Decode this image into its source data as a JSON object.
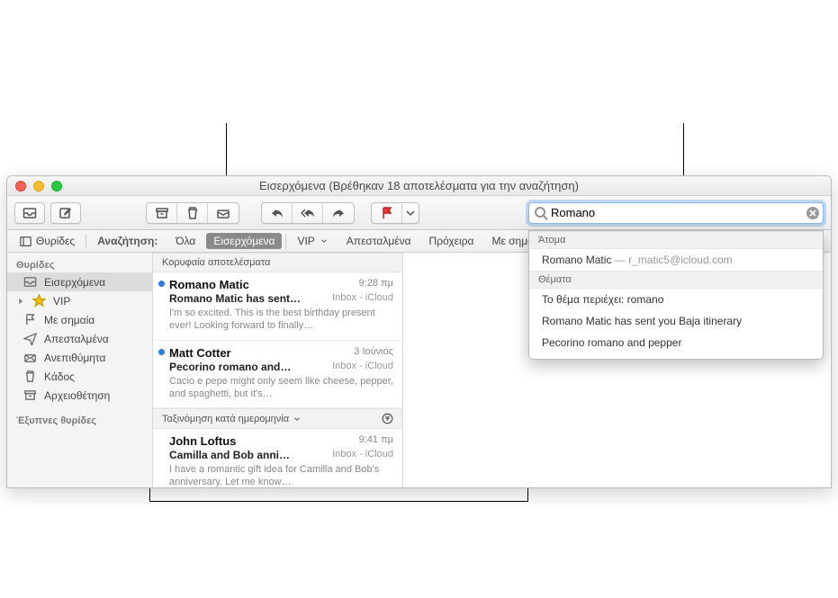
{
  "window": {
    "title": "Εισερχόμενα (Βρέθηκαν 18 αποτελέσματα για την αναζήτηση)"
  },
  "toolbar": {
    "icons": {
      "mailboxes": "mailboxes-icon",
      "compose": "compose-icon",
      "archive": "archive-icon",
      "trash": "trash-icon",
      "junk": "junk-icon",
      "reply": "reply-icon",
      "replyall": "reply-all-icon",
      "forward": "forward-icon",
      "flag": "flag-icon"
    }
  },
  "search": {
    "value": "Romano",
    "placeholder": ""
  },
  "favorites": {
    "sidebar_toggle": "Θυρίδες",
    "search_label": "Αναζήτηση:",
    "items": [
      {
        "label": "Όλα",
        "selected": false
      },
      {
        "label": "Εισερχόμενα",
        "selected": true
      },
      {
        "label": "VIP",
        "selected": false,
        "chevron": true
      },
      {
        "label": "Απεσταλμένα",
        "selected": false
      },
      {
        "label": "Πρόχειρα",
        "selected": false
      },
      {
        "label": "Με σημαία",
        "selected": false
      }
    ]
  },
  "sidebar": {
    "sections": [
      {
        "header": "Θυρίδες",
        "items": [
          {
            "icon": "inbox",
            "label": "Εισερχόμενα",
            "selected": true
          },
          {
            "icon": "star",
            "label": "VIP"
          },
          {
            "icon": "flag",
            "label": "Με σημαία"
          },
          {
            "icon": "sent",
            "label": "Απεσταλμένα"
          },
          {
            "icon": "junk",
            "label": "Ανεπιθύμητα"
          },
          {
            "icon": "trash",
            "label": "Κάδος"
          },
          {
            "icon": "archive",
            "label": "Αρχειοθέτηση"
          }
        ]
      },
      {
        "header": "Έξυπνες θυρίδες",
        "items": []
      }
    ]
  },
  "msglist": {
    "top_header": "Κορυφαία αποτελέσματα",
    "sort_header": "Ταξινόμηση κατά ημερομηνία",
    "messages_top": [
      {
        "unread": true,
        "sender": "Romano Matic",
        "date": "9:28 πμ",
        "subject": "Romano Matic has sent…",
        "mailbox": "Inbox - iCloud",
        "preview": "I'm so excited. This is the best birthday present ever! Looking forward to finally…"
      },
      {
        "unread": true,
        "sender": "Matt Cotter",
        "date": "3 Ιούνιος",
        "subject": "Pecorino romano and…",
        "mailbox": "Inbox - iCloud",
        "preview": "Cacio e pepe might only seem like cheese, pepper, and spaghetti, but it's…"
      }
    ],
    "messages_rest": [
      {
        "unread": false,
        "sender": "John Loftus",
        "date": "9:41 πμ",
        "subject": "Camilla and Bob anni…",
        "mailbox": "Inbox - iCloud",
        "preview": "I have a romantic gift idea for Camilla and Bob's anniversary. Let me know…"
      }
    ]
  },
  "suggestions": {
    "people_header": "Άτομα",
    "people": [
      {
        "name": "Romano Matic",
        "email": "r_matic5@icloud.com"
      }
    ],
    "subjects_header": "Θέματα",
    "subjects": [
      "Το θέμα περιέχει: romano",
      "Romano Matic has sent you Baja itinerary",
      "Pecorino romano and pepper"
    ]
  }
}
